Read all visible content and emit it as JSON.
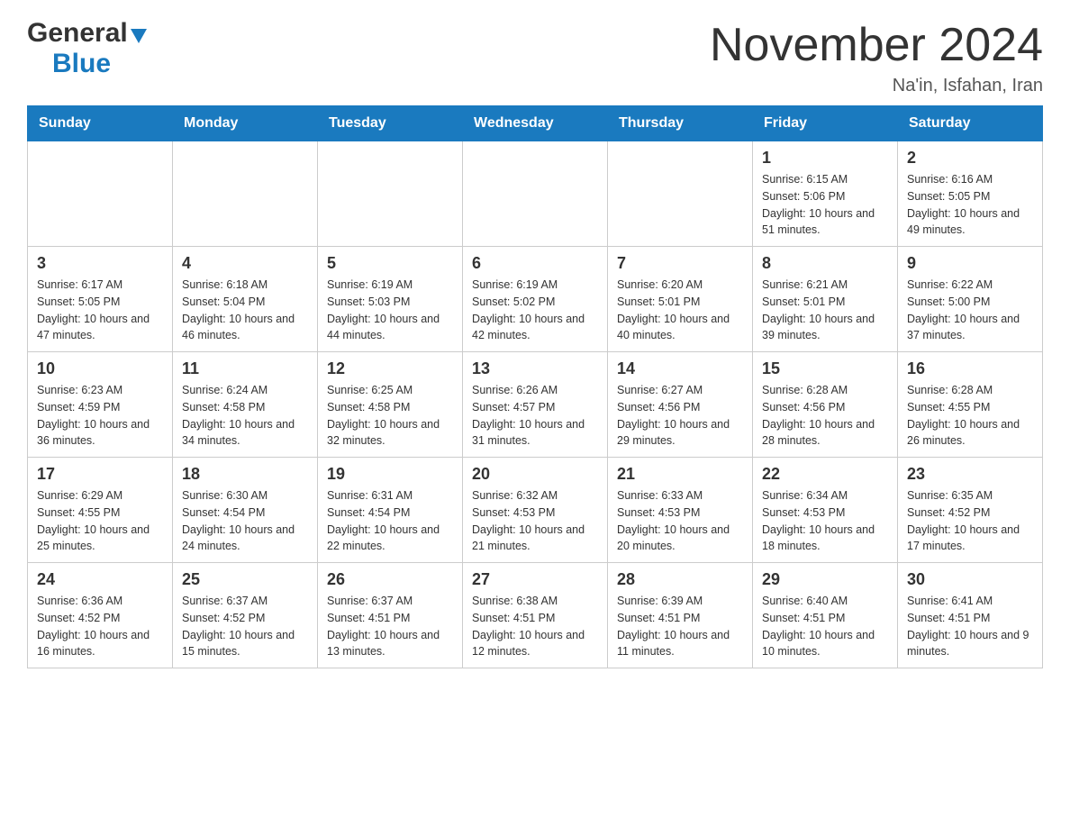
{
  "header": {
    "logo_general": "General",
    "logo_blue": "Blue",
    "month_title": "November 2024",
    "location": "Na'in, Isfahan, Iran"
  },
  "days_of_week": [
    "Sunday",
    "Monday",
    "Tuesday",
    "Wednesday",
    "Thursday",
    "Friday",
    "Saturday"
  ],
  "weeks": [
    {
      "days": [
        {
          "number": "",
          "info": ""
        },
        {
          "number": "",
          "info": ""
        },
        {
          "number": "",
          "info": ""
        },
        {
          "number": "",
          "info": ""
        },
        {
          "number": "",
          "info": ""
        },
        {
          "number": "1",
          "info": "Sunrise: 6:15 AM\nSunset: 5:06 PM\nDaylight: 10 hours and 51 minutes."
        },
        {
          "number": "2",
          "info": "Sunrise: 6:16 AM\nSunset: 5:05 PM\nDaylight: 10 hours and 49 minutes."
        }
      ]
    },
    {
      "days": [
        {
          "number": "3",
          "info": "Sunrise: 6:17 AM\nSunset: 5:05 PM\nDaylight: 10 hours and 47 minutes."
        },
        {
          "number": "4",
          "info": "Sunrise: 6:18 AM\nSunset: 5:04 PM\nDaylight: 10 hours and 46 minutes."
        },
        {
          "number": "5",
          "info": "Sunrise: 6:19 AM\nSunset: 5:03 PM\nDaylight: 10 hours and 44 minutes."
        },
        {
          "number": "6",
          "info": "Sunrise: 6:19 AM\nSunset: 5:02 PM\nDaylight: 10 hours and 42 minutes."
        },
        {
          "number": "7",
          "info": "Sunrise: 6:20 AM\nSunset: 5:01 PM\nDaylight: 10 hours and 40 minutes."
        },
        {
          "number": "8",
          "info": "Sunrise: 6:21 AM\nSunset: 5:01 PM\nDaylight: 10 hours and 39 minutes."
        },
        {
          "number": "9",
          "info": "Sunrise: 6:22 AM\nSunset: 5:00 PM\nDaylight: 10 hours and 37 minutes."
        }
      ]
    },
    {
      "days": [
        {
          "number": "10",
          "info": "Sunrise: 6:23 AM\nSunset: 4:59 PM\nDaylight: 10 hours and 36 minutes."
        },
        {
          "number": "11",
          "info": "Sunrise: 6:24 AM\nSunset: 4:58 PM\nDaylight: 10 hours and 34 minutes."
        },
        {
          "number": "12",
          "info": "Sunrise: 6:25 AM\nSunset: 4:58 PM\nDaylight: 10 hours and 32 minutes."
        },
        {
          "number": "13",
          "info": "Sunrise: 6:26 AM\nSunset: 4:57 PM\nDaylight: 10 hours and 31 minutes."
        },
        {
          "number": "14",
          "info": "Sunrise: 6:27 AM\nSunset: 4:56 PM\nDaylight: 10 hours and 29 minutes."
        },
        {
          "number": "15",
          "info": "Sunrise: 6:28 AM\nSunset: 4:56 PM\nDaylight: 10 hours and 28 minutes."
        },
        {
          "number": "16",
          "info": "Sunrise: 6:28 AM\nSunset: 4:55 PM\nDaylight: 10 hours and 26 minutes."
        }
      ]
    },
    {
      "days": [
        {
          "number": "17",
          "info": "Sunrise: 6:29 AM\nSunset: 4:55 PM\nDaylight: 10 hours and 25 minutes."
        },
        {
          "number": "18",
          "info": "Sunrise: 6:30 AM\nSunset: 4:54 PM\nDaylight: 10 hours and 24 minutes."
        },
        {
          "number": "19",
          "info": "Sunrise: 6:31 AM\nSunset: 4:54 PM\nDaylight: 10 hours and 22 minutes."
        },
        {
          "number": "20",
          "info": "Sunrise: 6:32 AM\nSunset: 4:53 PM\nDaylight: 10 hours and 21 minutes."
        },
        {
          "number": "21",
          "info": "Sunrise: 6:33 AM\nSunset: 4:53 PM\nDaylight: 10 hours and 20 minutes."
        },
        {
          "number": "22",
          "info": "Sunrise: 6:34 AM\nSunset: 4:53 PM\nDaylight: 10 hours and 18 minutes."
        },
        {
          "number": "23",
          "info": "Sunrise: 6:35 AM\nSunset: 4:52 PM\nDaylight: 10 hours and 17 minutes."
        }
      ]
    },
    {
      "days": [
        {
          "number": "24",
          "info": "Sunrise: 6:36 AM\nSunset: 4:52 PM\nDaylight: 10 hours and 16 minutes."
        },
        {
          "number": "25",
          "info": "Sunrise: 6:37 AM\nSunset: 4:52 PM\nDaylight: 10 hours and 15 minutes."
        },
        {
          "number": "26",
          "info": "Sunrise: 6:37 AM\nSunset: 4:51 PM\nDaylight: 10 hours and 13 minutes."
        },
        {
          "number": "27",
          "info": "Sunrise: 6:38 AM\nSunset: 4:51 PM\nDaylight: 10 hours and 12 minutes."
        },
        {
          "number": "28",
          "info": "Sunrise: 6:39 AM\nSunset: 4:51 PM\nDaylight: 10 hours and 11 minutes."
        },
        {
          "number": "29",
          "info": "Sunrise: 6:40 AM\nSunset: 4:51 PM\nDaylight: 10 hours and 10 minutes."
        },
        {
          "number": "30",
          "info": "Sunrise: 6:41 AM\nSunset: 4:51 PM\nDaylight: 10 hours and 9 minutes."
        }
      ]
    }
  ]
}
